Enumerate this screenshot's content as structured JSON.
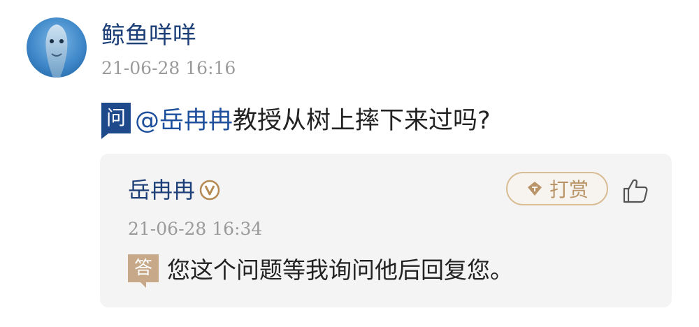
{
  "asker": {
    "name": "鲸鱼咩咩",
    "time": "21-06-28 16:16",
    "avatar_icon": "dolphin-avatar"
  },
  "question": {
    "tag": "问",
    "mention": "@岳冉冉",
    "text": "教授从树上摔下来过吗?"
  },
  "answer": {
    "answerer_name": "岳冉冉",
    "verified_icon": "verified-v-badge-icon",
    "reward_label": "打赏",
    "reward_icon": "diamond-icon",
    "like_icon": "thumbs-up-icon",
    "time": "21-06-28 16:34",
    "tag": "答",
    "text": "您这个问题等我询问他后回复您。"
  },
  "colors": {
    "name_blue": "#1d3f78",
    "question_tag": "#1e4a8c",
    "answer_tag": "#c7a98a",
    "reward_border": "#d8bd95",
    "card_bg": "#f4f4f4"
  }
}
